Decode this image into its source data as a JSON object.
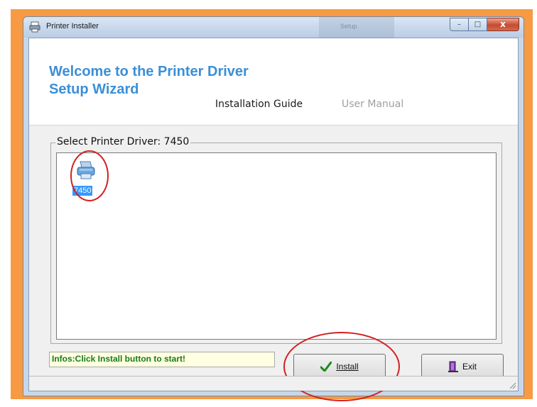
{
  "window": {
    "title": "Printer Installer",
    "background_taskbar_text": "Setup",
    "buttons": {
      "minimize": "–",
      "maximize": "□",
      "close": "x"
    }
  },
  "header": {
    "welcome_title": "Welcome to the Printer Driver Setup Wizard",
    "nav": {
      "installation_guide": "Installation Guide",
      "user_manual": "User Manual"
    }
  },
  "driver_group": {
    "label": "Select Printer Driver: 7450",
    "items": [
      {
        "label": "7450",
        "icon": "printer-icon",
        "selected": true
      }
    ]
  },
  "infos": "Infos:Click Install button to start!",
  "buttons": {
    "install": "Install",
    "exit": "Exit"
  },
  "colors": {
    "accent": "#3a8fd8",
    "selection": "#3399ff",
    "annotation": "#d32020",
    "frame": "#f79a43"
  }
}
